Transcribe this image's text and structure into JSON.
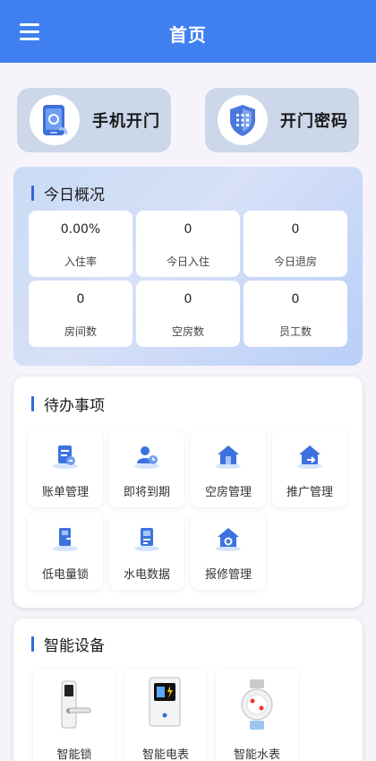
{
  "header": {
    "title": "首页",
    "menu_icon": "menu-icon"
  },
  "quick_actions": [
    {
      "label": "手机开门",
      "icon": "phone-unlock-icon"
    },
    {
      "label": "开门密码",
      "icon": "keypad-shield-icon"
    }
  ],
  "overview": {
    "title": "今日概况",
    "stats": [
      {
        "value": "0.00%",
        "label": "入住率"
      },
      {
        "value": "0",
        "label": "今日入住"
      },
      {
        "value": "0",
        "label": "今日退房"
      },
      {
        "value": "0",
        "label": "房间数"
      },
      {
        "value": "0",
        "label": "空房数"
      },
      {
        "value": "0",
        "label": "员工数"
      }
    ]
  },
  "todo": {
    "title": "待办事项",
    "items": [
      {
        "label": "账单管理",
        "icon": "bill-icon"
      },
      {
        "label": "即将到期",
        "icon": "user-clock-icon"
      },
      {
        "label": "空房管理",
        "icon": "house-icon"
      },
      {
        "label": "推广管理",
        "icon": "house-share-icon"
      },
      {
        "label": "低电量锁",
        "icon": "door-lock-icon"
      },
      {
        "label": "水电数据",
        "icon": "meter-icon"
      },
      {
        "label": "报修管理",
        "icon": "house-repair-icon"
      }
    ]
  },
  "devices": {
    "title": "智能设备",
    "items": [
      {
        "label": "智能锁",
        "icon": "smart-lock-icon"
      },
      {
        "label": "智能电表",
        "icon": "electric-meter-icon"
      },
      {
        "label": "智能水表",
        "icon": "water-meter-icon"
      }
    ]
  },
  "colors": {
    "accent": "#3f7ff0",
    "title_bar": "#3366dd",
    "quick_bg": "#ccd7ea"
  }
}
